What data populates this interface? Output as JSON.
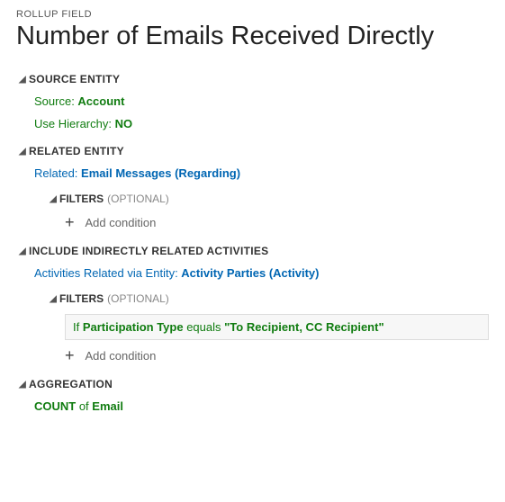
{
  "breadcrumb": "ROLLUP FIELD",
  "title": "Number of Emails Received Directly",
  "sections": {
    "source_entity": {
      "header": "SOURCE ENTITY",
      "source_label": "Source: ",
      "source_value": "Account",
      "hierarchy_label": "Use Hierarchy: ",
      "hierarchy_value": "NO"
    },
    "related_entity": {
      "header": "RELATED ENTITY",
      "related_label": "Related: ",
      "related_value": "Email Messages (Regarding)",
      "filters_header": "FILTERS",
      "filters_optional": "(OPTIONAL)",
      "add_condition": "Add condition"
    },
    "indirect": {
      "header": "INCLUDE INDIRECTLY RELATED ACTIVITIES",
      "via_label": "Activities Related via Entity: ",
      "via_value": "Activity Parties (Activity)",
      "filters_header": "FILTERS",
      "filters_optional": "(OPTIONAL)",
      "condition_if": "If ",
      "condition_field": "Participation Type",
      "condition_op": " equals ",
      "condition_value": "\"To Recipient, CC Recipient\"",
      "add_condition": "Add condition"
    },
    "aggregation": {
      "header": "AGGREGATION",
      "fn": "COUNT",
      "of": " of ",
      "field": "Email"
    }
  }
}
